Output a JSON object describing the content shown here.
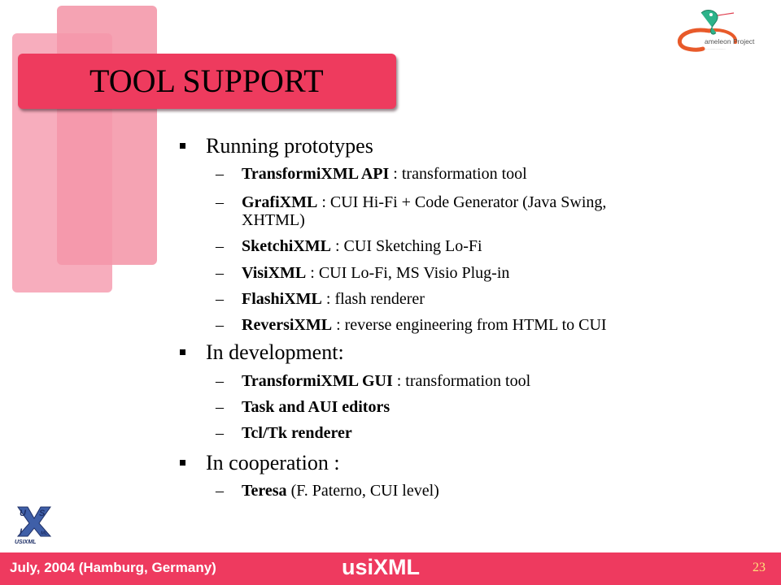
{
  "slide": {
    "title": "TOOL SUPPORT",
    "page_number": "23"
  },
  "logos": {
    "top_right": {
      "icon": "cameleon-project-logo",
      "text": "ameleon Project",
      "initial": "C"
    },
    "bottom_left": {
      "icon": "usixml-logo",
      "text": "USIXML"
    }
  },
  "sections": [
    {
      "heading": "Running prototypes",
      "items": [
        {
          "bold": "TransformiXML API",
          "text": " : transformation tool"
        },
        {
          "bold": "GrafiXML",
          "text": " : CUI Hi-Fi + Code Generator (Java Swing,",
          "continuation": "XHTML)"
        },
        {
          "bold": "SketchiXML",
          "text": " : CUI Sketching Lo-Fi"
        },
        {
          "bold": "VisiXML",
          "text": " : CUI Lo-Fi, MS Visio Plug-in"
        },
        {
          "bold": "FlashiXML",
          "text": " : flash renderer"
        },
        {
          "bold": "ReversiXML",
          "text": " : reverse engineering from HTML to CUI"
        }
      ]
    },
    {
      "heading": "In development:",
      "items": [
        {
          "bold": "TransformiXML GUI",
          "text": " : transformation tool"
        },
        {
          "bold": "Task and AUI editors",
          "text": ""
        },
        {
          "bold": "Tcl/Tk renderer",
          "text": ""
        }
      ]
    },
    {
      "heading": "In cooperation :",
      "items": [
        {
          "bold": "Teresa",
          "text": " (F. Paterno, CUI level)"
        }
      ]
    }
  ],
  "footer": {
    "date_location": "July, 2004 (Hamburg, Germany)",
    "brand": "usiXML",
    "page": "23"
  },
  "colors": {
    "accent": "#EE3B5E",
    "deco_light": "#F5A3B3",
    "page_number": "#FFE27A"
  },
  "symbols": {
    "dash": "–"
  }
}
